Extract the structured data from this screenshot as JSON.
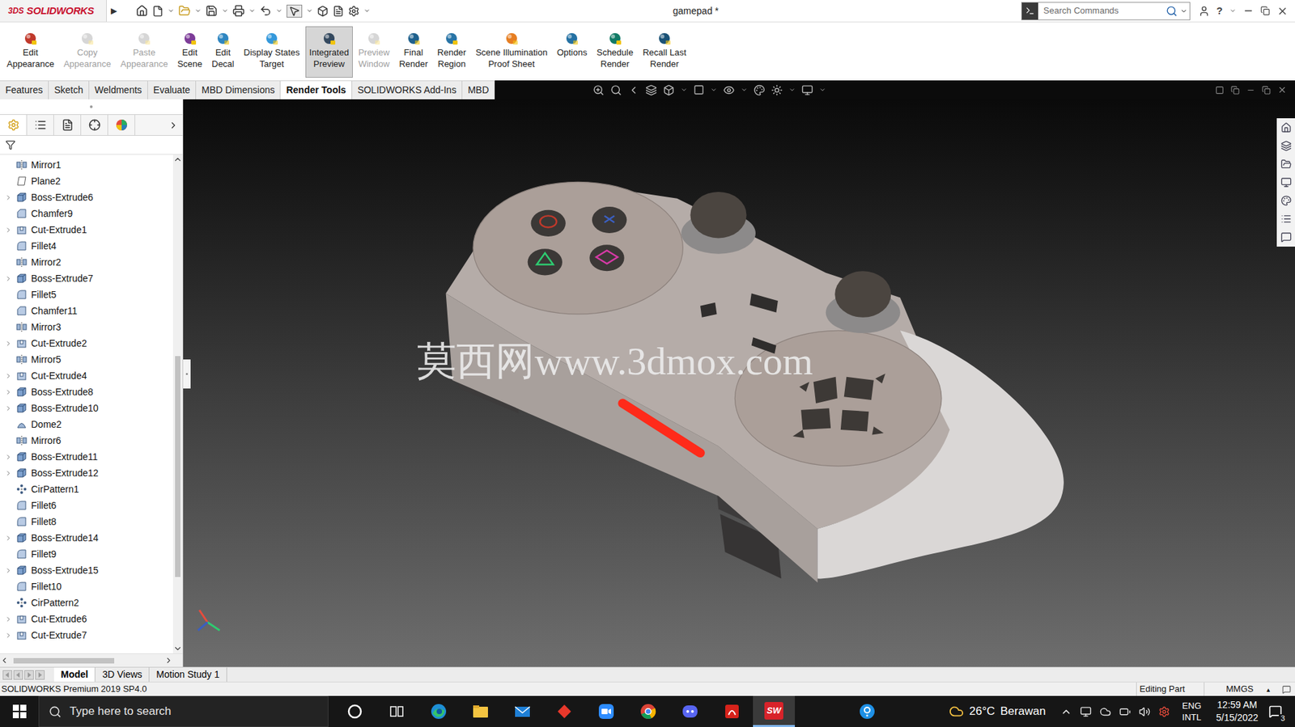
{
  "app": {
    "logo_mark": "3DS",
    "logo_name": "SOLIDWORKS",
    "menu_arrow": "▶",
    "help": "?"
  },
  "window": {
    "title": "gamepad *"
  },
  "search": {
    "placeholder": "Search Commands"
  },
  "ribbon": [
    {
      "lines": [
        "Edit",
        "Appearance"
      ],
      "disabled": false,
      "selected": false
    },
    {
      "lines": [
        "Copy",
        "Appearance"
      ],
      "disabled": true,
      "selected": false
    },
    {
      "lines": [
        "Paste",
        "Appearance"
      ],
      "disabled": true,
      "selected": false
    },
    {
      "lines": [
        "Edit",
        "Scene"
      ],
      "disabled": false,
      "selected": false
    },
    {
      "lines": [
        "Edit",
        "Decal"
      ],
      "disabled": false,
      "selected": false
    },
    {
      "lines": [
        "Display States",
        "Target"
      ],
      "disabled": false,
      "selected": false
    },
    {
      "lines": [
        "Integrated",
        "Preview"
      ],
      "disabled": false,
      "selected": true
    },
    {
      "lines": [
        "Preview",
        "Window"
      ],
      "disabled": true,
      "selected": false
    },
    {
      "lines": [
        "Final",
        "Render"
      ],
      "disabled": false,
      "selected": false
    },
    {
      "lines": [
        "Render",
        "Region"
      ],
      "disabled": false,
      "selected": false
    },
    {
      "lines": [
        "Scene Illumination",
        "Proof Sheet"
      ],
      "disabled": false,
      "selected": false
    },
    {
      "lines": [
        "Options"
      ],
      "disabled": false,
      "selected": false
    },
    {
      "lines": [
        "Schedule",
        "Render"
      ],
      "disabled": false,
      "selected": false
    },
    {
      "lines": [
        "Recall Last",
        "Render"
      ],
      "disabled": false,
      "selected": false
    }
  ],
  "tabs": [
    {
      "label": "Features",
      "selected": false
    },
    {
      "label": "Sketch",
      "selected": false
    },
    {
      "label": "Weldments",
      "selected": false
    },
    {
      "label": "Evaluate",
      "selected": false
    },
    {
      "label": "MBD Dimensions",
      "selected": false
    },
    {
      "label": "Render Tools",
      "selected": true
    },
    {
      "label": "SOLIDWORKS Add-Ins",
      "selected": false
    },
    {
      "label": "MBD",
      "selected": false
    }
  ],
  "feature_tree": {
    "scroll_top": 0.4,
    "scroll_size": 0.46,
    "hscroll_left": 0.03,
    "hscroll_size": 0.65,
    "items": [
      {
        "name": "Mirror1",
        "kind": "mirror",
        "has_children": false
      },
      {
        "name": "Plane2",
        "kind": "plane",
        "has_children": false
      },
      {
        "name": "Boss-Extrude6",
        "kind": "boss",
        "has_children": true
      },
      {
        "name": "Chamfer9",
        "kind": "chamfer",
        "has_children": false
      },
      {
        "name": "Cut-Extrude1",
        "kind": "cut",
        "has_children": true
      },
      {
        "name": "Fillet4",
        "kind": "fillet",
        "has_children": false
      },
      {
        "name": "Mirror2",
        "kind": "mirror",
        "has_children": false
      },
      {
        "name": "Boss-Extrude7",
        "kind": "boss",
        "has_children": true
      },
      {
        "name": "Fillet5",
        "kind": "fillet",
        "has_children": false
      },
      {
        "name": "Chamfer11",
        "kind": "chamfer",
        "has_children": false
      },
      {
        "name": "Mirror3",
        "kind": "mirror",
        "has_children": false
      },
      {
        "name": "Cut-Extrude2",
        "kind": "cut",
        "has_children": true
      },
      {
        "name": "Mirror5",
        "kind": "mirror",
        "has_children": false
      },
      {
        "name": "Cut-Extrude4",
        "kind": "cut",
        "has_children": true
      },
      {
        "name": "Boss-Extrude8",
        "kind": "boss",
        "has_children": true
      },
      {
        "name": "Boss-Extrude10",
        "kind": "boss",
        "has_children": true
      },
      {
        "name": "Dome2",
        "kind": "dome",
        "has_children": false
      },
      {
        "name": "Mirror6",
        "kind": "mirror",
        "has_children": false
      },
      {
        "name": "Boss-Extrude11",
        "kind": "boss",
        "has_children": true
      },
      {
        "name": "Boss-Extrude12",
        "kind": "boss",
        "has_children": true
      },
      {
        "name": "CirPattern1",
        "kind": "pattern",
        "has_children": false
      },
      {
        "name": "Fillet6",
        "kind": "fillet",
        "has_children": false
      },
      {
        "name": "Fillet8",
        "kind": "fillet",
        "has_children": false
      },
      {
        "name": "Boss-Extrude14",
        "kind": "boss",
        "has_children": true
      },
      {
        "name": "Fillet9",
        "kind": "fillet",
        "has_children": false
      },
      {
        "name": "Boss-Extrude15",
        "kind": "boss",
        "has_children": true
      },
      {
        "name": "Fillet10",
        "kind": "fillet",
        "has_children": false
      },
      {
        "name": "CirPattern2",
        "kind": "pattern",
        "has_children": false
      },
      {
        "name": "Cut-Extrude6",
        "kind": "cut",
        "has_children": true
      },
      {
        "name": "Cut-Extrude7",
        "kind": "cut",
        "has_children": true
      }
    ]
  },
  "watermark": "莫西网www.3dmox.com",
  "bottom_tabs": [
    {
      "label": "Model",
      "selected": true
    },
    {
      "label": "3D Views",
      "selected": false
    },
    {
      "label": "Motion Study 1",
      "selected": false
    }
  ],
  "status_bar": {
    "product": "SOLIDWORKS Premium 2019 SP4.0",
    "mode": "Editing Part",
    "units": "MMGS",
    "units_arrow": "▴"
  },
  "taskbar": {
    "search_placeholder": "Type here to search",
    "apps": [
      {
        "kind": "cortana",
        "active": false
      },
      {
        "kind": "taskview",
        "active": false
      },
      {
        "kind": "edge",
        "active": false
      },
      {
        "kind": "explorer",
        "active": false
      },
      {
        "kind": "mail",
        "active": false
      },
      {
        "kind": "diamond",
        "active": false
      },
      {
        "kind": "zoom",
        "active": false
      },
      {
        "kind": "chrome",
        "active": false
      },
      {
        "kind": "discord",
        "active": false
      },
      {
        "kind": "acrobat",
        "active": false
      },
      {
        "kind": "solidworks",
        "active": true,
        "label": "SW"
      },
      {
        "kind": "gethelp",
        "active": false
      }
    ],
    "weather": {
      "temp": "26°C",
      "condition": "Berawan"
    },
    "language": [
      "ENG",
      "INTL"
    ],
    "time": "12:59 AM",
    "date": "5/15/2022",
    "notifications": "3"
  }
}
